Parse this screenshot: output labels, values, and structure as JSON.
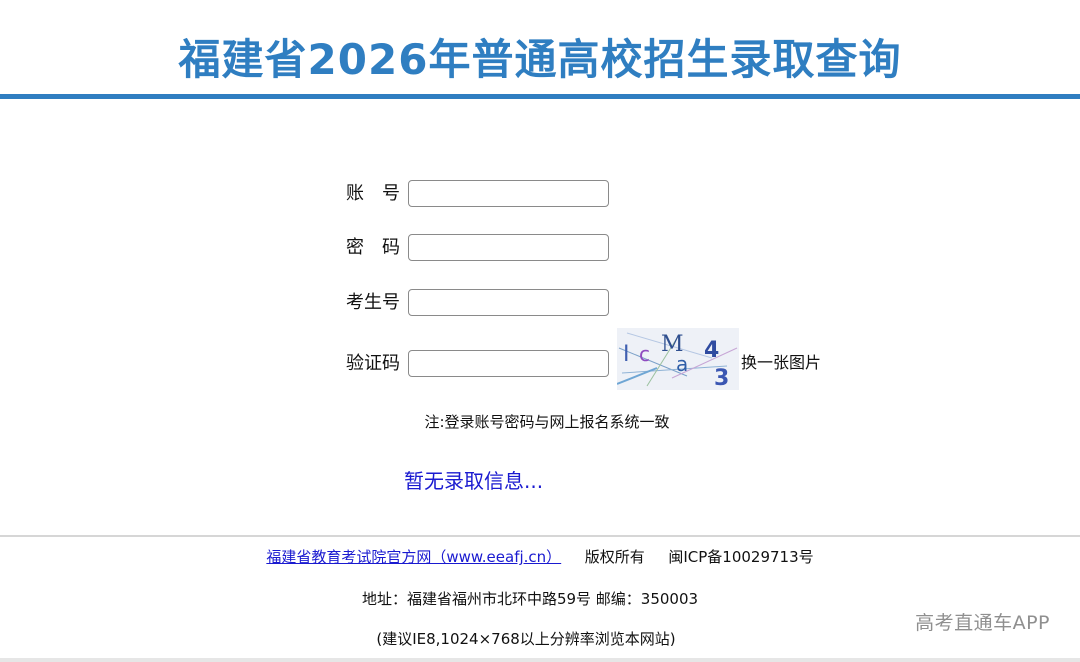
{
  "header": {
    "title": "福建省2026年普通高校招生录取查询"
  },
  "form": {
    "account_label": "账　号",
    "account_value": "",
    "password_label": "密　码",
    "password_value": "",
    "exam_no_label": "考生号",
    "exam_no_value": "",
    "captcha_label": "验证码",
    "captcha_value": "",
    "captcha_refresh": "换一张图片",
    "captcha_chars": [
      "I",
      "c",
      "M",
      "a",
      "4",
      "3"
    ]
  },
  "note": "注:登录账号密码与网上报名系统一致",
  "result_message": "暂无录取信息...",
  "footer": {
    "site_link": "福建省教育考试院官方网（www.eeafj.cn）",
    "copyright": "版权所有",
    "icp": "闽ICP备10029713号",
    "address": "地址：福建省福州市北环中路59号 邮编：350003",
    "browser_hint": "(建议IE8,1024×768以上分辨率浏览本网站)"
  },
  "watermark": "高考直通车APP",
  "colors": {
    "title": "#2f7ec1",
    "link": "#1a1ad0"
  }
}
